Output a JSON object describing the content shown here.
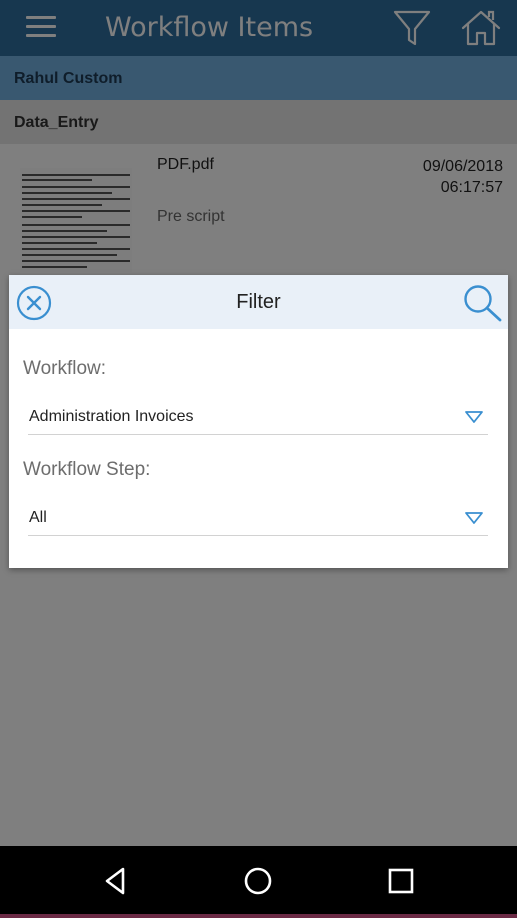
{
  "header": {
    "title": "Workflow Items",
    "menu_icon": "hamburger-menu-icon",
    "filter_icon": "funnel-filter-icon",
    "home_icon": "home-icon"
  },
  "list": {
    "group_label": "Rahul Custom",
    "step_label": "Data_Entry",
    "items": [
      {
        "name": "PDF.pdf",
        "date": "09/06/2018",
        "time": "06:17:57",
        "script": "Pre script"
      }
    ]
  },
  "filter_dialog": {
    "title": "Filter",
    "workflow_label": "Workflow:",
    "workflow_value": "Administration Invoices",
    "step_label": "Workflow Step:",
    "step_value": "All",
    "close_icon": "close-circle-icon",
    "search_icon": "search-icon"
  },
  "colors": {
    "header_bg": "#2f6f9f",
    "group_bg": "#73b1e0",
    "accent": "#3a8fd0"
  }
}
